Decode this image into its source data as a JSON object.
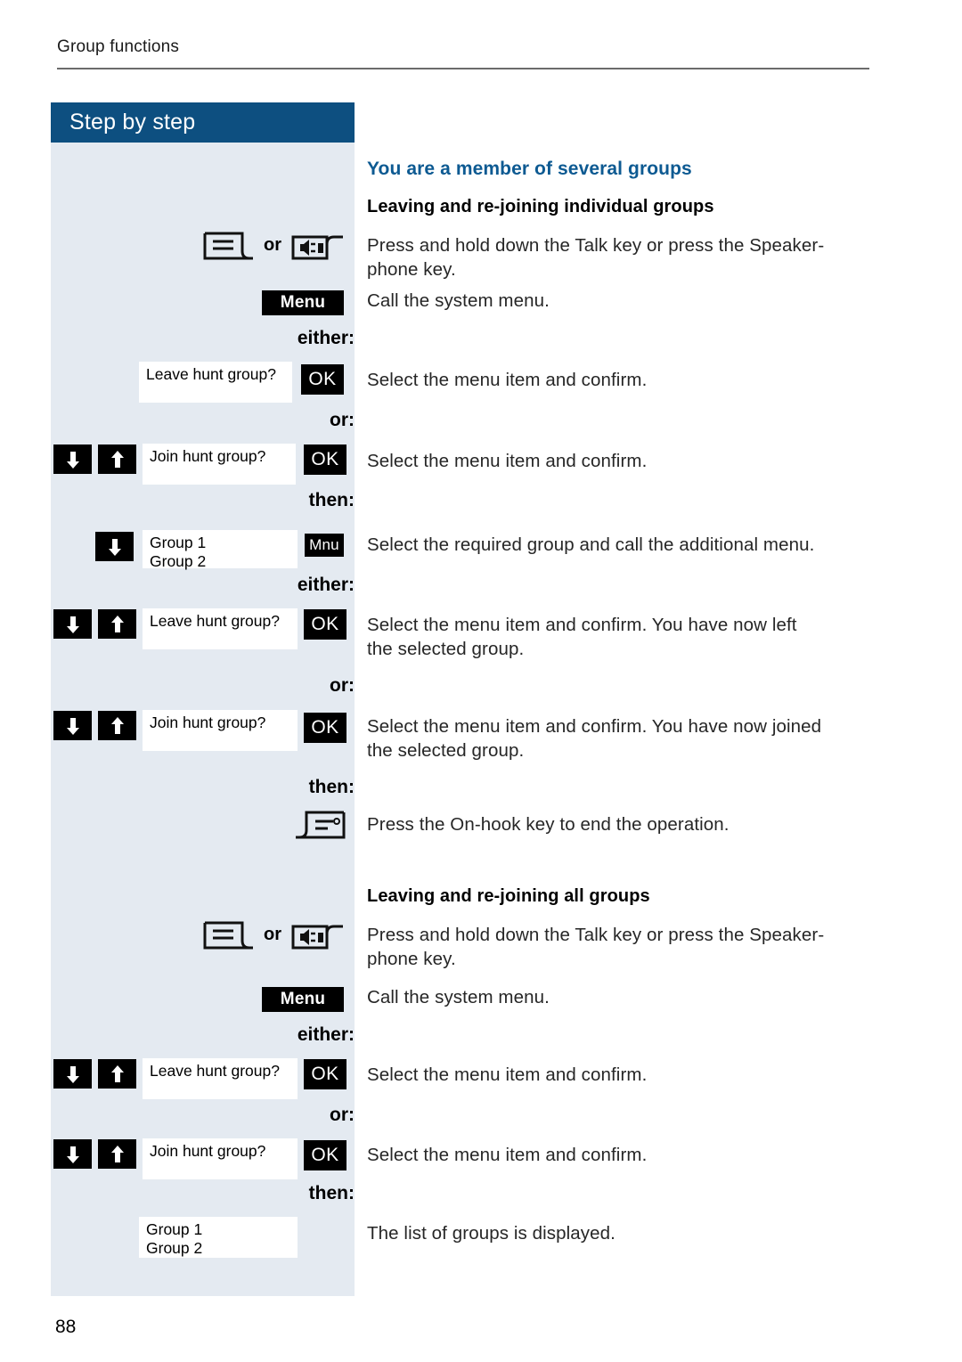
{
  "page": {
    "running_header": "Group functions",
    "number": "88",
    "panel_title": "Step by step"
  },
  "colors": {
    "panel_header_blue": "#0d4f80",
    "panel_background": "#e4eaf1",
    "heading_blue": "#0d5a92",
    "key_black": "#000000",
    "display_white": "#ffffff"
  },
  "section_heading": "You are a member of several groups",
  "subsections": [
    {
      "heading": "Leaving and re-joining individual groups"
    },
    {
      "heading": "Leaving and re-joining all groups"
    }
  ],
  "connectors": {
    "either": "either:",
    "or": "or:",
    "then": "then:"
  },
  "keys": {
    "or_word": "or",
    "talk_key": "talk-key-icon",
    "speaker_key": "speakerphone-key-icon",
    "onhook_key": "on-hook-key-icon",
    "arrow_down": "arrow-down-key-icon",
    "arrow_up": "arrow-up-key-icon"
  },
  "softkeys": {
    "menu": "Menu",
    "ok": "OK",
    "mnu": "Mnu"
  },
  "displays": {
    "leave_hunt_group": "Leave hunt group?",
    "join_hunt_group": "Join hunt group?",
    "group_1": "Group 1",
    "group_2": "Group 2"
  },
  "instructions": {
    "press_hold_talk": "Press and hold down the Talk key or press the Speaker-phone key.",
    "call_system_menu": "Call the system menu.",
    "select_confirm": "Select the menu item and confirm.",
    "select_group_additional_menu": "Select the required group and call the additional menu.",
    "select_confirm_left": "Select the menu item and confirm. You have now left the selected group.",
    "select_confirm_joined": "Select the menu item and confirm. You have now joined the selected group.",
    "press_onhook": "Press the On-hook key to end the operation.",
    "list_displayed": "The list of groups is displayed."
  },
  "instruction_lines": {
    "press_hold_talk_1": "Press and hold down the Talk key or press the Speaker-",
    "press_hold_talk_2": "phone key.",
    "select_confirm_left_1": "Select the menu item and confirm. You have now left",
    "select_confirm_left_2": "the selected group.",
    "select_confirm_joined_1": "Select the menu item and confirm. You have now joined",
    "select_confirm_joined_2": "the selected group."
  }
}
